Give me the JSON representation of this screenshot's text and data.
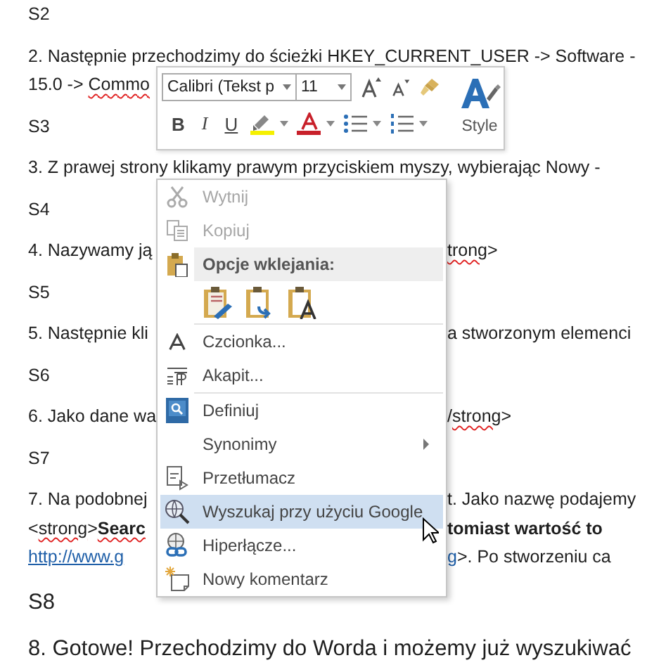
{
  "document": {
    "paragraphs": [
      {
        "lines": [
          {
            "left": [
              {
                "kind": "text",
                "text": "S2"
              }
            ]
          }
        ]
      },
      {
        "lines": [
          {
            "left": [
              {
                "kind": "text",
                "text": "2. Następnie przechodzimy do ścieżki HKEY_CURRENT_USER -> Software -"
              }
            ]
          },
          {
            "left": [
              {
                "kind": "text",
                "text": "15.0 -> "
              },
              {
                "kind": "misspelled",
                "text": "Commo"
              }
            ]
          }
        ]
      },
      {
        "lines": [
          {
            "left": [
              {
                "kind": "text",
                "text": "S3"
              }
            ]
          }
        ]
      },
      {
        "lines": [
          {
            "left": [
              {
                "kind": "text",
                "text": "3. Z prawej strony klikamy prawym przyciskiem myszy, wybierając Nowy -"
              }
            ]
          }
        ]
      },
      {
        "lines": [
          {
            "left": [
              {
                "kind": "text",
                "text": "S4"
              }
            ]
          }
        ]
      },
      {
        "lines": [
          {
            "left": [
              {
                "kind": "text",
                "text": "4. Nazywamy ją"
              }
            ],
            "right": [
              {
                "kind": "misspelled",
                "text": "trong"
              },
              {
                "kind": "text",
                "text": ">"
              }
            ]
          }
        ]
      },
      {
        "lines": [
          {
            "left": [
              {
                "kind": "text",
                "text": "S5"
              }
            ]
          }
        ]
      },
      {
        "lines": [
          {
            "left": [
              {
                "kind": "text",
                "text": "5. Następnie kli"
              }
            ],
            "right": [
              {
                "kind": "text",
                "text": "a stworzonym elemenci"
              }
            ]
          }
        ]
      },
      {
        "lines": [
          {
            "left": [
              {
                "kind": "text",
                "text": "S6"
              }
            ]
          }
        ]
      },
      {
        "lines": [
          {
            "left": [
              {
                "kind": "text",
                "text": "6. Jako dane wa"
              }
            ],
            "right": [
              {
                "kind": "text",
                "text": "/"
              },
              {
                "kind": "misspelled",
                "text": "strong"
              },
              {
                "kind": "text",
                "text": ">"
              }
            ]
          }
        ]
      },
      {
        "lines": [
          {
            "left": [
              {
                "kind": "text",
                "text": "S7"
              }
            ]
          }
        ]
      },
      {
        "lines": [
          {
            "left": [
              {
                "kind": "text",
                "text": "7. Na podobnej"
              }
            ],
            "right": [
              {
                "kind": "text",
                "text": "t. Jako nazwę podajemy"
              }
            ]
          },
          {
            "left": [
              {
                "kind": "text",
                "text": "<"
              },
              {
                "kind": "misspelled",
                "text": "strong"
              },
              {
                "kind": "text",
                "text": ">"
              },
              {
                "kind": "misspelled",
                "text": "**Searc**"
              }
            ],
            "right": [
              {
                "kind": "text",
                "text": "**tomiast wartość to**"
              }
            ]
          },
          {
            "left": [
              {
                "kind": "link",
                "text": "http://www.g"
              }
            ],
            "right": [
              {
                "kind": "link",
                "text": "g"
              },
              {
                "kind": "text",
                "text": ">. Po stworzeniu ca"
              }
            ]
          }
        ]
      }
    ],
    "large_paragraphs": [
      {
        "lines": [
          {
            "left": [
              {
                "kind": "text",
                "text": "S8"
              }
            ]
          }
        ]
      },
      {
        "lines": [
          {
            "left": [
              {
                "kind": "text",
                "text": "8. Gotowe! Przechodzimy do Worda i możemy już wyszukiwać"
              }
            ]
          }
        ]
      }
    ]
  },
  "mini_toolbar": {
    "font_field": "Calibri (Tekst p",
    "size_field": "11",
    "format_buttons": [
      "B",
      "I",
      "U"
    ],
    "style_button": "Style"
  },
  "context_menu": {
    "items": [
      {
        "kind": "command",
        "label": "Wytnij",
        "disabled": true,
        "selected": false,
        "submenu": false
      },
      {
        "kind": "command",
        "label": "Kopiuj",
        "disabled": true,
        "selected": false,
        "submenu": false
      },
      {
        "kind": "header",
        "label": "Opcje wklejania:"
      },
      {
        "kind": "paste-options"
      },
      {
        "kind": "separator"
      },
      {
        "kind": "command",
        "label": "Czcionka...",
        "disabled": false,
        "selected": false,
        "submenu": false
      },
      {
        "kind": "command",
        "label": "Akapit...",
        "disabled": false,
        "selected": false,
        "submenu": false
      },
      {
        "kind": "separator"
      },
      {
        "kind": "command",
        "label": "Definiuj",
        "disabled": false,
        "selected": false,
        "submenu": false
      },
      {
        "kind": "command",
        "label": "Synonimy",
        "disabled": false,
        "selected": false,
        "submenu": true
      },
      {
        "kind": "command",
        "label": "Przetłumacz",
        "disabled": false,
        "selected": false,
        "submenu": false
      },
      {
        "kind": "command",
        "label": "Wyszukaj przy użyciu Google",
        "disabled": false,
        "selected": true,
        "submenu": false
      },
      {
        "kind": "command",
        "label": "Hiperłącze...",
        "disabled": false,
        "selected": false,
        "submenu": false
      },
      {
        "kind": "command",
        "label": "Nowy komentarz",
        "disabled": false,
        "selected": false,
        "submenu": false
      }
    ]
  }
}
